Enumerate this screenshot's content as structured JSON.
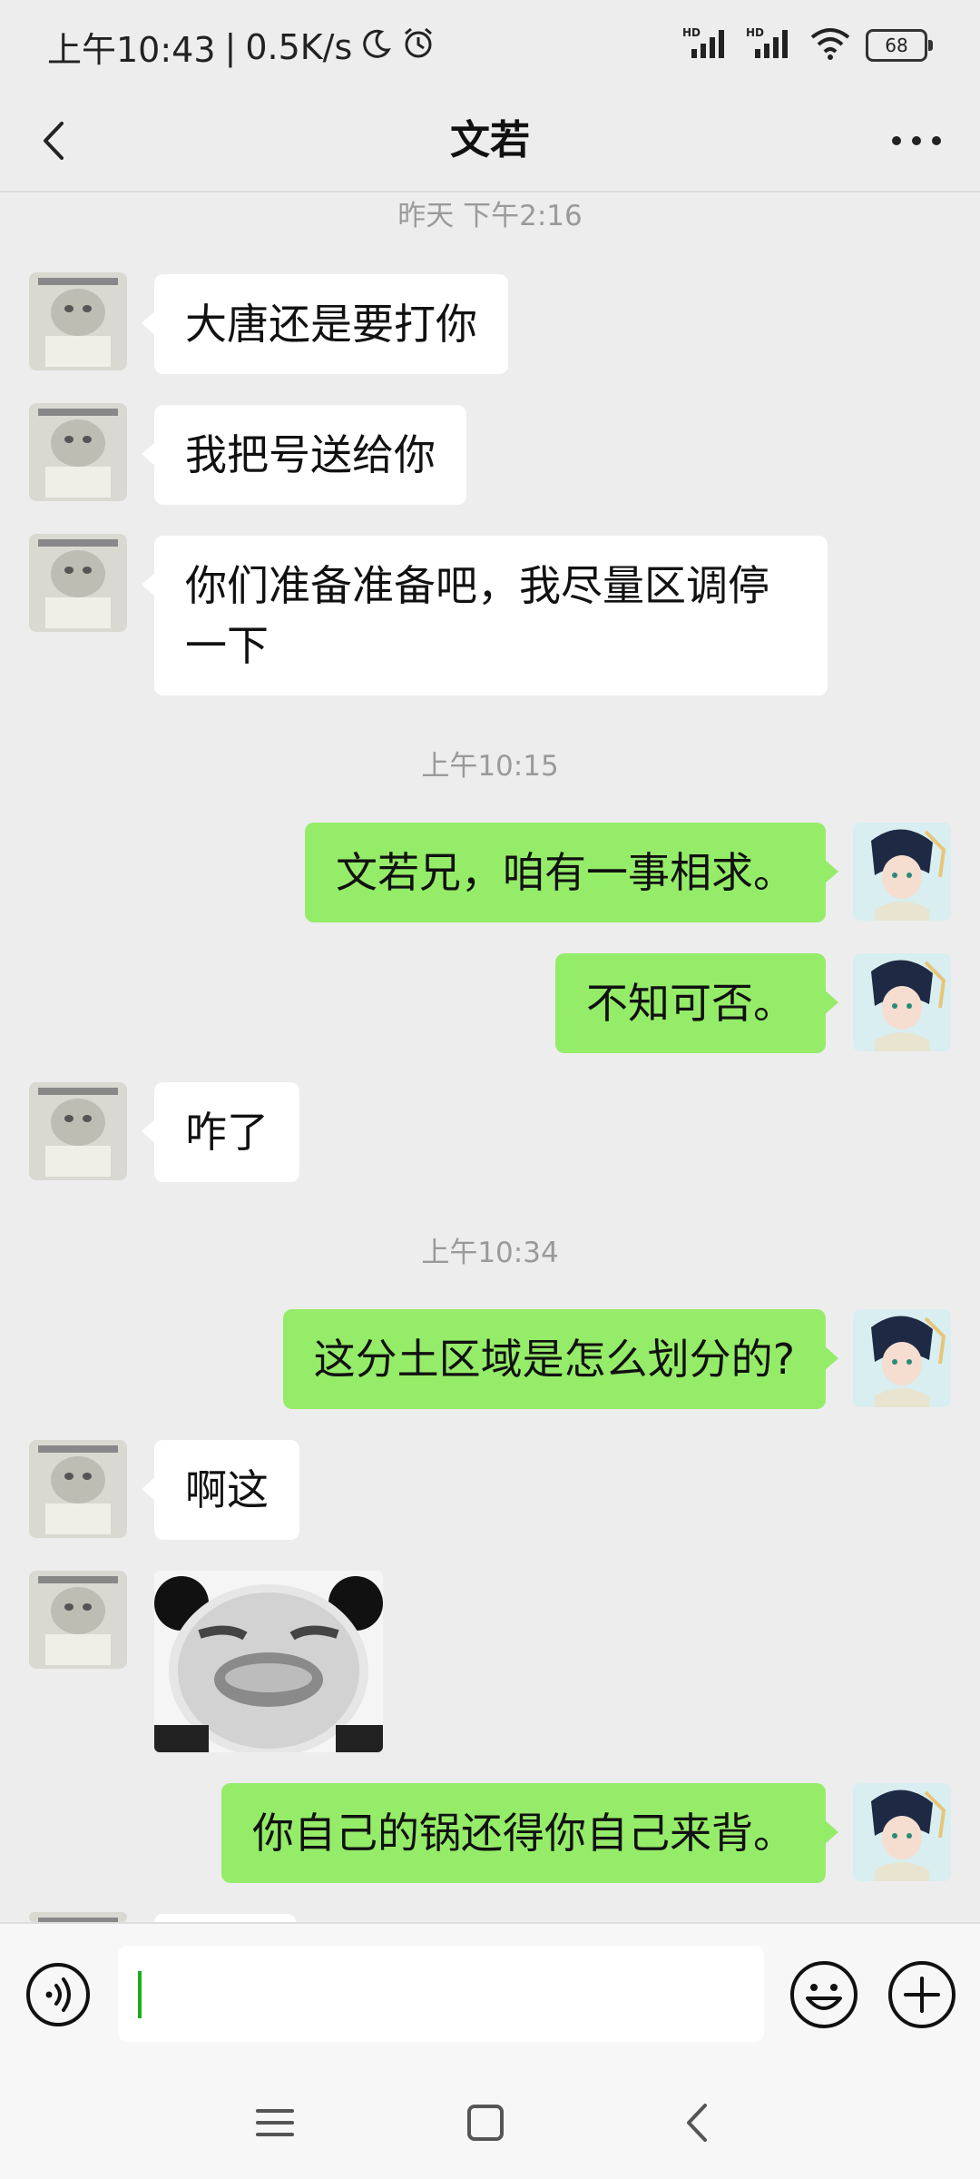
{
  "status_bar": {
    "time": "上午10:43",
    "separator": "|",
    "speed": "0.5K/s",
    "icons": [
      "moon-icon",
      "alarm-icon",
      "hd-signal-icon",
      "hd-signal-icon",
      "wifi-icon"
    ],
    "battery": "68"
  },
  "header": {
    "title": "文若"
  },
  "messages": [
    {
      "type": "timestamp",
      "text": "昨天 下午2:16"
    },
    {
      "type": "in",
      "text": "大唐还是要打你"
    },
    {
      "type": "in",
      "text": "我把号送给你"
    },
    {
      "type": "in",
      "text": "你们准备准备吧，我尽量区调停一下"
    },
    {
      "type": "timestamp",
      "text": "上午10:15"
    },
    {
      "type": "out",
      "text": "文若兄，咱有一事相求。"
    },
    {
      "type": "out",
      "text": "不知可否。"
    },
    {
      "type": "in",
      "text": "咋了"
    },
    {
      "type": "timestamp",
      "text": "上午10:34"
    },
    {
      "type": "out",
      "text": "这分土区域是怎么划分的?"
    },
    {
      "type": "in",
      "text": "啊这"
    },
    {
      "type": "in_sticker",
      "text": ""
    },
    {
      "type": "out",
      "text": "你自己的锅还得你自己来背。"
    }
  ],
  "input": {
    "value": "",
    "placeholder": ""
  },
  "colors": {
    "background": "#ededed",
    "bubble_out": "#95ec69",
    "bubble_in": "#ffffff",
    "timestamp": "#9a9a9a"
  }
}
